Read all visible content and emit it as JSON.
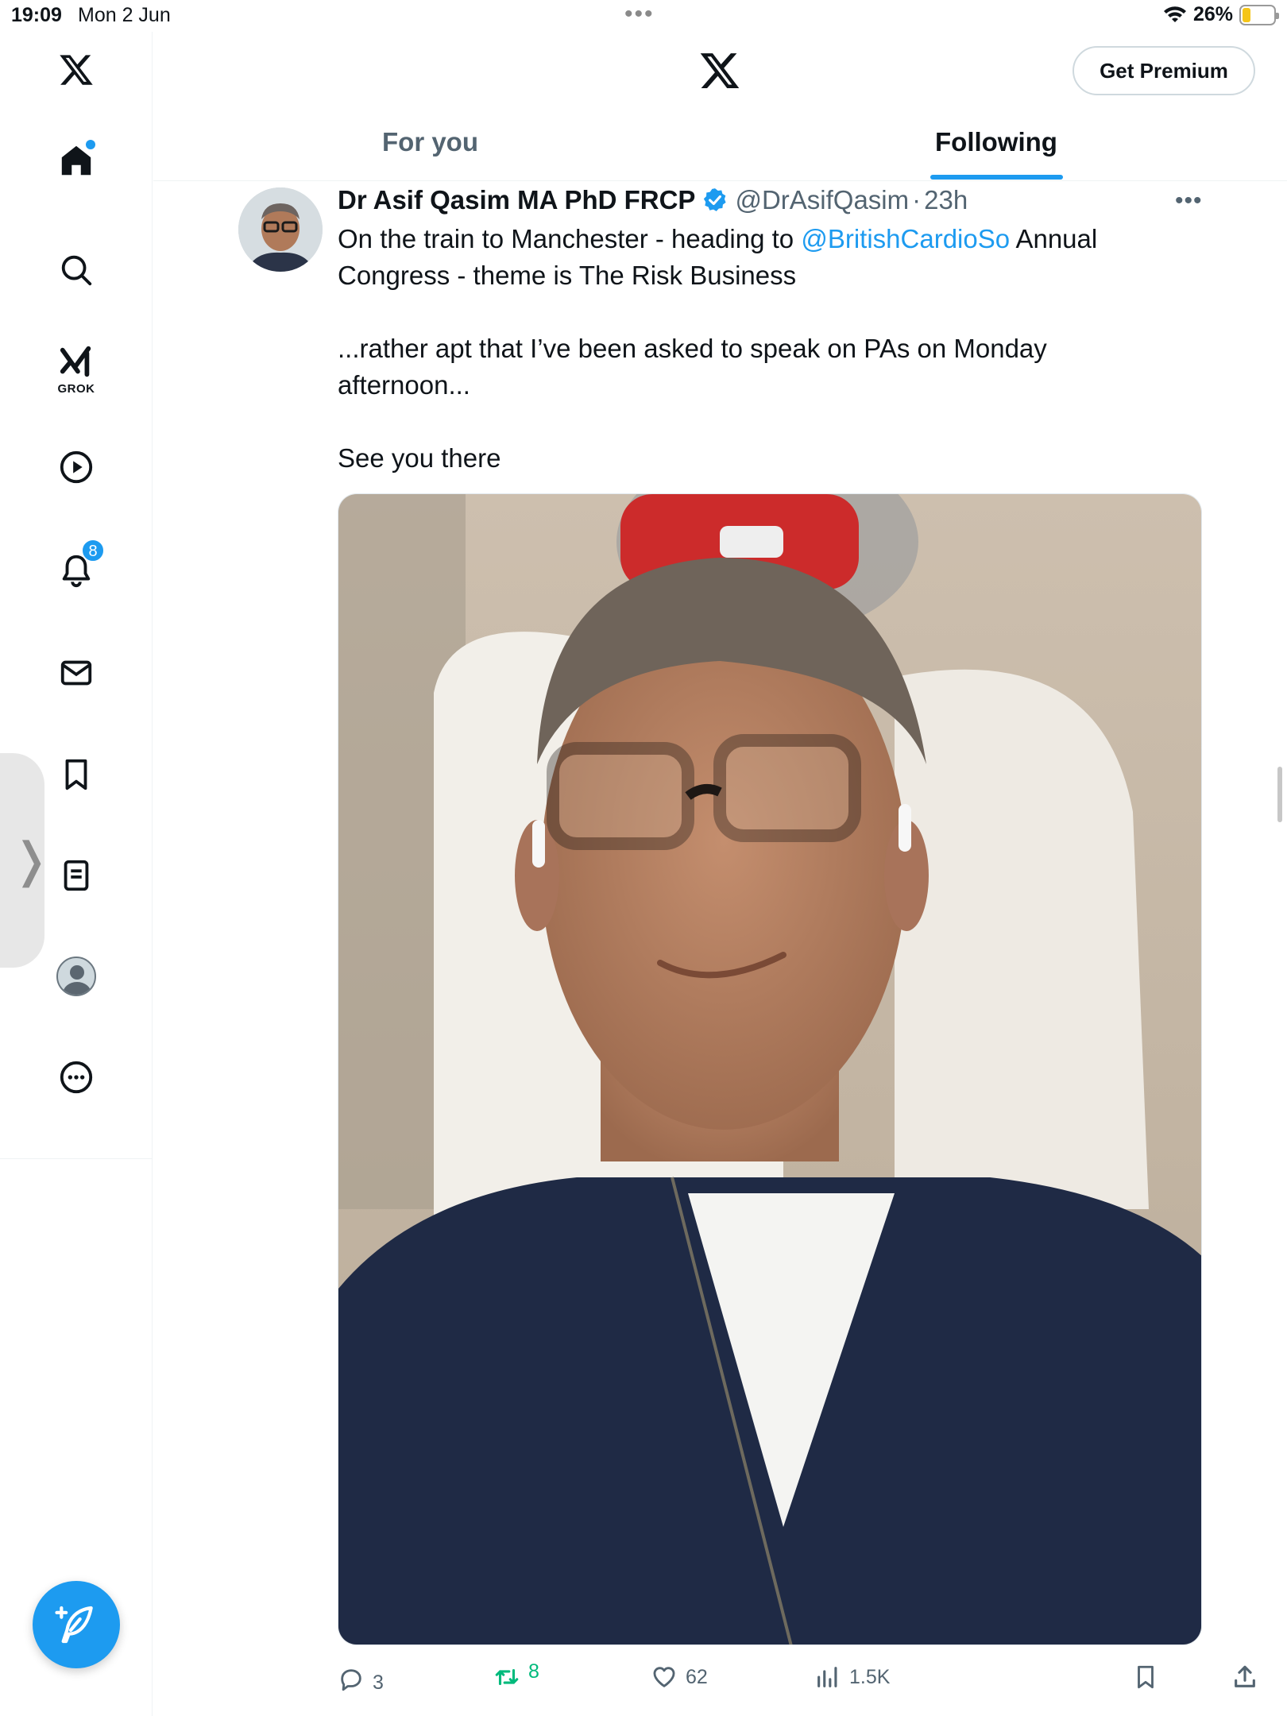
{
  "status_bar": {
    "time": "19:09",
    "date": "Mon 2 Jun",
    "battery": "26%",
    "battery_fill": 0.26
  },
  "sidebar": {
    "items": [
      {
        "name": "home",
        "icon": "home-icon"
      },
      {
        "name": "search",
        "icon": "search-icon"
      },
      {
        "name": "grok",
        "icon": "grok-icon",
        "label": "GROK"
      },
      {
        "name": "video",
        "icon": "play-icon"
      },
      {
        "name": "notifications",
        "icon": "bell-icon",
        "badge": "8"
      },
      {
        "name": "messages",
        "icon": "mail-icon"
      },
      {
        "name": "bookmarks",
        "icon": "bookmark-icon"
      },
      {
        "name": "lists",
        "icon": "list-icon"
      },
      {
        "name": "profile",
        "icon": "avatar"
      },
      {
        "name": "more",
        "icon": "more-circle-icon"
      }
    ],
    "handle_glyph": "❭"
  },
  "header": {
    "premium_label": "Get Premium",
    "tabs": [
      {
        "label": "For you",
        "active": false
      },
      {
        "label": "Following",
        "active": true
      }
    ]
  },
  "tweet": {
    "author_name": "Dr Asif Qasim MA PhD FRCP",
    "author_handle": "@DrAsifQasim",
    "separator": "·",
    "timestamp": "23h",
    "more_glyph": "•••",
    "text": {
      "line1_before": "On the train to Manchester - heading to ",
      "mention": "@BritishCardioSo",
      "line1_after": " Annual",
      "line2": "Congress - theme is The Risk Business",
      "para2_line1": "...rather apt that I’ve been asked to speak on PAs on Monday",
      "para2_line2": "afternoon...",
      "para3": "See you there"
    },
    "stats": {
      "replies": "3",
      "retweets": "8",
      "likes": "62",
      "views": "1.5K"
    }
  },
  "colors": {
    "accent": "#1d9bf0",
    "retweet": "#00ba7c",
    "secondary_text": "#536471"
  }
}
